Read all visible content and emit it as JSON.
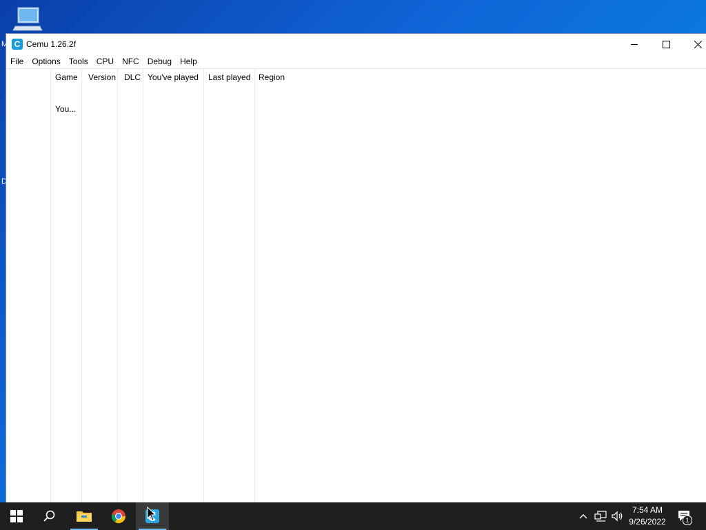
{
  "window": {
    "title": "Cemu 1.26.2f",
    "app_icon_letter": "C"
  },
  "menu": [
    "File",
    "Options",
    "Tools",
    "CPU",
    "NFC",
    "Debug",
    "Help"
  ],
  "game_list": {
    "columns": [
      "Game",
      "Version",
      "DLC",
      "You've played",
      "Last played",
      "Region"
    ],
    "rows": [
      {
        "game": "You..."
      }
    ]
  },
  "desktop": {
    "edge_letters": [
      "M",
      "D"
    ]
  },
  "taskbar": {
    "apps": [
      "windows-start",
      "search",
      "file-explorer",
      "chrome",
      "cemu"
    ],
    "clock_time": "7:54 AM",
    "clock_date": "9/26/2022",
    "notification_count": "1"
  },
  "colors": {
    "accent": "#1a9ad6",
    "taskbar": "#1f1f1f",
    "desktop": "#0f63d6"
  }
}
